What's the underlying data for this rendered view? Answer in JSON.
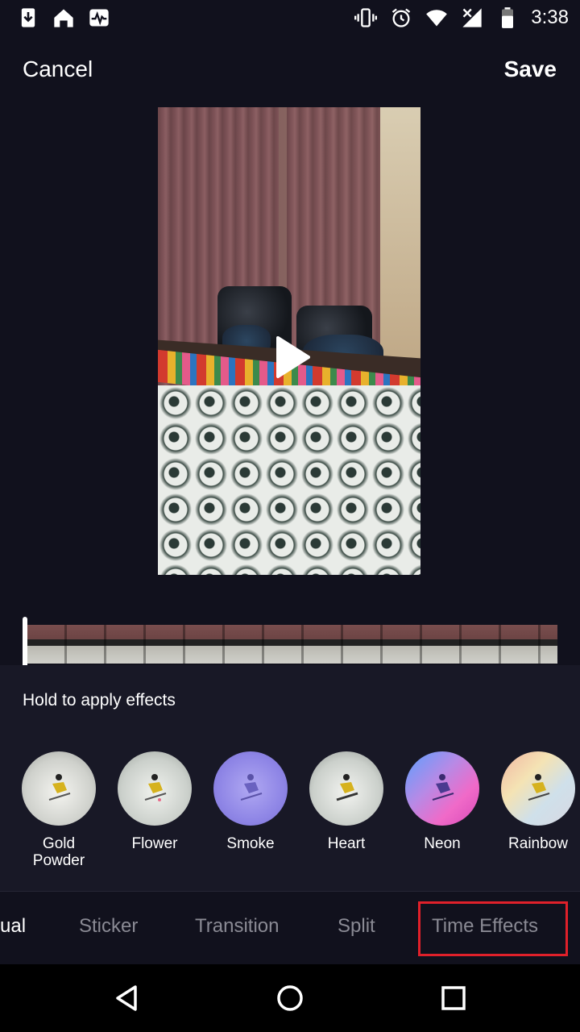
{
  "status_bar": {
    "time": "3:38",
    "left_icons": [
      "download-icon",
      "home-icon",
      "pulse-icon"
    ],
    "right_icons": [
      "vibrate-icon",
      "alarm-icon",
      "wifi-icon",
      "signal-icon",
      "battery-icon"
    ]
  },
  "header": {
    "cancel_label": "Cancel",
    "save_label": "Save"
  },
  "preview": {
    "play_icon": "play-icon"
  },
  "effects_panel": {
    "hint": "Hold to apply effects",
    "effects": [
      {
        "label": "Gold Powder",
        "tint": "#d6d8d4"
      },
      {
        "label": "Flower",
        "tint": "#cfd4cf"
      },
      {
        "label": "Smoke",
        "tint": "#8f86e6"
      },
      {
        "label": "Heart",
        "tint": "#d3d6d2"
      },
      {
        "label": "Neon",
        "tint": "#c27ad8"
      },
      {
        "label": "Rainbow",
        "tint": "#e9d6c4"
      }
    ]
  },
  "tabs": {
    "visual": "ual",
    "sticker": "Sticker",
    "transition": "Transition",
    "split": "Split",
    "time_effects": "Time Effects"
  },
  "colors": {
    "background": "#11111d",
    "panel": "#181826",
    "highlight": "#e0202a"
  }
}
